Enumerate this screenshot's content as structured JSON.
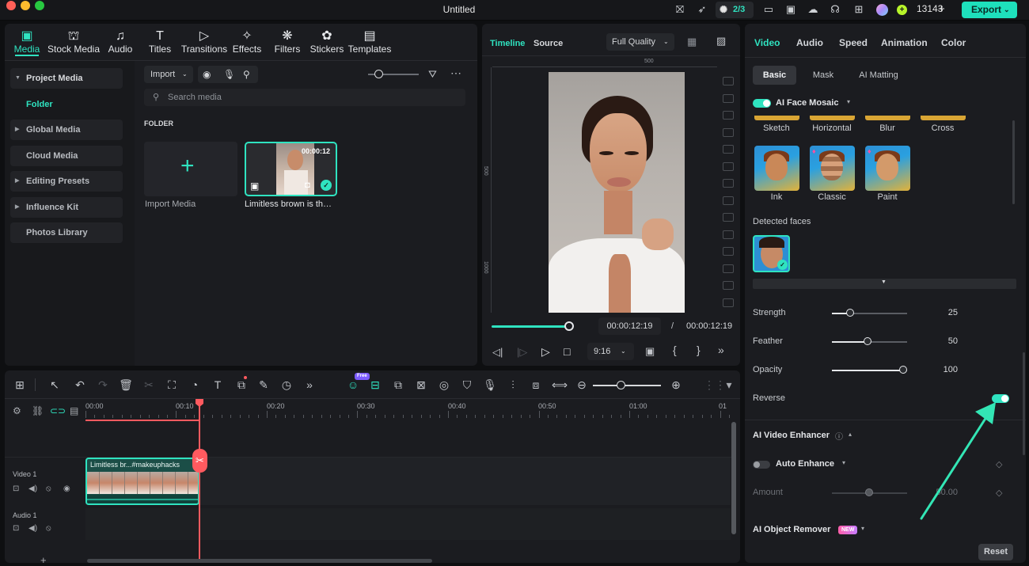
{
  "app": {
    "title": "Untitled",
    "credits": "13143",
    "task_badge": "2/3",
    "export_label": "Export"
  },
  "colors": {
    "accent": "#2fe3c0",
    "playhead": "#ff5a5f",
    "export_bg": "#1ee0bc"
  },
  "media_tabs": [
    {
      "label": "Media",
      "icon": "media-icon"
    },
    {
      "label": "Stock Media",
      "icon": "stock-media-icon"
    },
    {
      "label": "Audio",
      "icon": "audio-icon"
    },
    {
      "label": "Titles",
      "icon": "titles-icon"
    },
    {
      "label": "Transitions",
      "icon": "transitions-icon"
    },
    {
      "label": "Effects",
      "icon": "effects-icon"
    },
    {
      "label": "Filters",
      "icon": "filters-icon"
    },
    {
      "label": "Stickers",
      "icon": "stickers-icon"
    },
    {
      "label": "Templates",
      "icon": "templates-icon"
    }
  ],
  "sidebar": {
    "items": [
      {
        "label": "Project Media"
      },
      {
        "label": "Folder"
      },
      {
        "label": "Global Media"
      },
      {
        "label": "Cloud Media"
      },
      {
        "label": "Editing Presets"
      },
      {
        "label": "Influence Kit"
      },
      {
        "label": "Photos Library"
      }
    ]
  },
  "library": {
    "import_label": "Import",
    "search_placeholder": "Search media",
    "folder_heading": "FOLDER",
    "import_media_label": "Import Media",
    "clip_name": "Limitless brown is th…",
    "clip_duration": "00:00:12"
  },
  "player": {
    "tab_timeline": "Timeline",
    "tab_source": "Source",
    "quality": "Full Quality",
    "ruler_top": "500",
    "ruler_side_1": "500",
    "ruler_side_2": "1000",
    "current_time": "00:00:12:19",
    "separator": "/",
    "total_time": "00:00:12:19",
    "aspect": "9:16",
    "progress": 1.0
  },
  "inspector": {
    "tabs": [
      "Video",
      "Audio",
      "Speed",
      "Animation",
      "Color"
    ],
    "subtabs": [
      "Basic",
      "Mask",
      "AI Matting"
    ],
    "face_mosaic_label": "AI Face Mosaic",
    "styles_row1": [
      "Sketch",
      "Horizontal",
      "Blur",
      "Cross"
    ],
    "styles_row2": [
      "Ink",
      "Classic",
      "Paint"
    ],
    "detected_faces_label": "Detected faces",
    "sliders": [
      {
        "label": "Strength",
        "value": "25",
        "fraction": 0.25
      },
      {
        "label": "Feather",
        "value": "50",
        "fraction": 0.5
      },
      {
        "label": "Opacity",
        "value": "100",
        "fraction": 1.0
      }
    ],
    "reverse_label": "Reverse",
    "enhancer_label": "AI Video Enhancer",
    "auto_enhance_label": "Auto Enhance",
    "amount_label": "Amount",
    "amount_value": "50.00",
    "object_remover_label": "AI Object Remover",
    "new_badge": "NEW",
    "reset_label": "Reset"
  },
  "timeline": {
    "ruler": [
      "00:00",
      "00:10",
      "00:20",
      "00:30",
      "00:40",
      "00:50",
      "01:00",
      "01"
    ],
    "video_track_label": "Video 1",
    "audio_track_label": "Audio 1",
    "clip_title": "Limitless br...#makeuphacks",
    "zoom_free_badge": "Free"
  }
}
